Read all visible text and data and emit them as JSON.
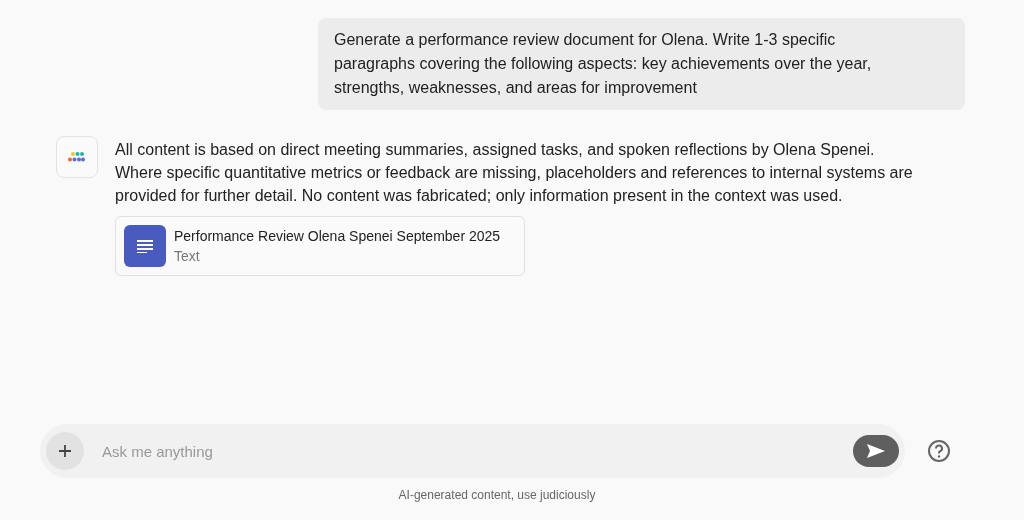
{
  "user_message": "Generate a performance review document for Olena. Write 1-3 specific paragraphs covering the following aspects: key achievements over the year, strengths, weaknesses, and areas for improvement",
  "assistant_message": "All content is based on direct meeting summaries, assigned tasks, and spoken reflections by Olena Spenei. Where specific quantitative metrics or feedback are missing, placeholders and references to internal systems are provided for further detail. No content was fabricated; only information present in the context was used.",
  "attachment": {
    "title": "Performance Review Olena Spenei September 2025",
    "type": "Text"
  },
  "composer": {
    "placeholder": "Ask me anything"
  },
  "disclaimer": "AI-generated content, use judiciously"
}
